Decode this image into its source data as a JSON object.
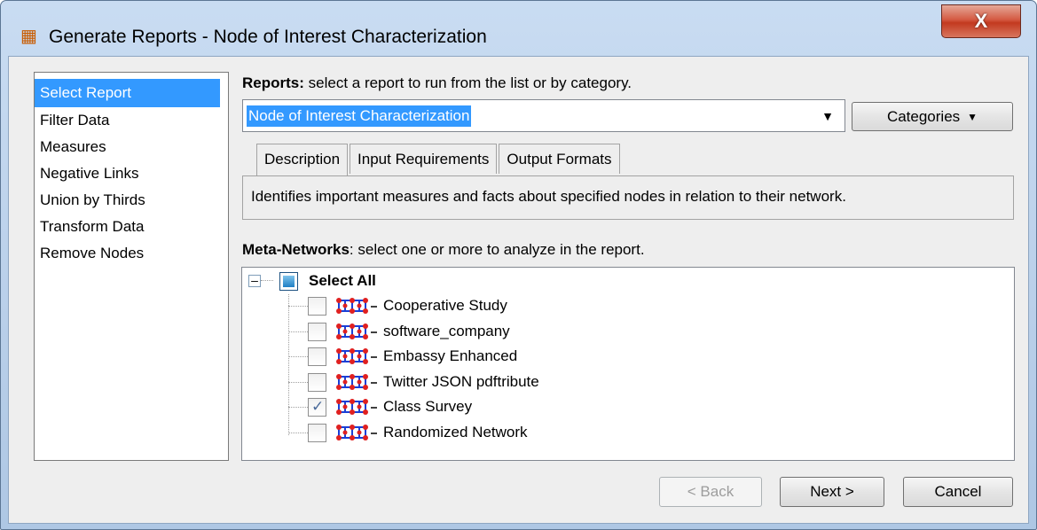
{
  "window": {
    "title": "Generate Reports - Node of Interest Characterization",
    "close_glyph": "X",
    "app_icon": "network-app-icon"
  },
  "nav": {
    "items": [
      {
        "label": "Select Report",
        "selected": true
      },
      {
        "label": "Filter Data"
      },
      {
        "label": "Measures"
      },
      {
        "label": "Negative Links"
      },
      {
        "label": "Union by Thirds"
      },
      {
        "label": "Transform Data"
      },
      {
        "label": "Remove Nodes"
      }
    ]
  },
  "reports": {
    "label_bold": "Reports:",
    "label_rest": " select a report to run from the list or by category.",
    "selected_value": "Node of Interest Characterization",
    "categories_label": "Categories"
  },
  "tabs": [
    {
      "label": "Description",
      "active": true
    },
    {
      "label": "Input Requirements"
    },
    {
      "label": "Output Formats"
    }
  ],
  "description": "Identifies important measures and facts about specified nodes in relation to their network.",
  "meta_networks": {
    "label_bold": "Meta-Networks",
    "label_rest": ": select one or more to analyze in the report.",
    "select_all": "Select All",
    "items": [
      {
        "name": "Cooperative Study",
        "checked": false
      },
      {
        "name": "software_company",
        "checked": false
      },
      {
        "name": "Embassy Enhanced",
        "checked": false
      },
      {
        "name": "Twitter JSON pdftribute",
        "checked": false
      },
      {
        "name": "Class Survey",
        "checked": true
      },
      {
        "name": "Randomized Network",
        "checked": false
      }
    ]
  },
  "buttons": {
    "back": "< Back",
    "next": "Next >",
    "cancel": "Cancel"
  },
  "colors": {
    "selection": "#3399ff",
    "close": "#c3391f"
  }
}
